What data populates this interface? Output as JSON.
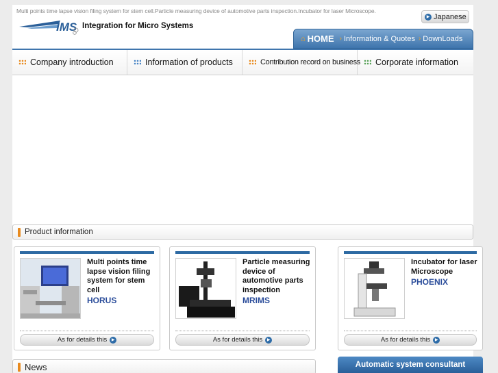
{
  "header": {
    "tagline": "Multi points time lapse vision filing system for stem cell.Particle measuring device of automotive parts inspection.Incubator for laser Microscope.",
    "language_button": "Japanese",
    "logo_text": "IMS",
    "brand_name": "Integration for Micro Systems"
  },
  "nav": {
    "tabs": [
      {
        "label": "HOME"
      },
      {
        "label": "Information & Quotes"
      },
      {
        "label": "DownLoads"
      }
    ]
  },
  "menu": {
    "items": [
      {
        "label": "Company introduction",
        "icon": "orange-grid-icon"
      },
      {
        "label": "Information of products",
        "icon": "blue-grid-icon"
      },
      {
        "label": "Contribution record on business",
        "icon": "orange-grid-icon"
      },
      {
        "label": "Corporate information",
        "icon": "green-grid-icon"
      }
    ]
  },
  "sections": {
    "product_info": "Product information",
    "news": "News"
  },
  "products": [
    {
      "description": "Multi points time lapse vision filing system for stem cell",
      "name": "HORUS",
      "details": "As for details this"
    },
    {
      "description": "Particle measuring device of automotive parts inspection",
      "name": "MRIMS",
      "details": "As for details this"
    },
    {
      "description": "Incubator for laser Microscope",
      "name": "PHOENIX",
      "details": "As for details this"
    }
  ],
  "sidebar": {
    "consult_button": "Automatic system consultant"
  },
  "colors": {
    "accent_blue": "#3f75ad",
    "accent_orange": "#e88a1e",
    "product_name": "#2a4c9a"
  }
}
